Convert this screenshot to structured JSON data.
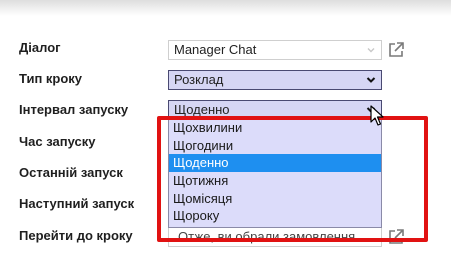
{
  "form": {
    "labels": {
      "dialog": "Діалог",
      "step_type": "Тип кроку",
      "interval": "Інтервал запуску",
      "run_time": "Час запуску",
      "last_run": "Останній запуск",
      "next_run": "Наступний запуск",
      "go_to_step": "Перейти до кроку"
    },
    "dialog_value": "Manager Chat",
    "step_type_value": "Розклад",
    "interval_value": "Щоденно",
    "go_to_step_value": "Отже, ви обрали замовлення"
  },
  "interval_dropdown": {
    "options": [
      "Щохвилини",
      "Щогодини",
      "Щоденно",
      "Щотижня",
      "Щомісяця",
      "Щороку"
    ],
    "selected": "Щоденно"
  },
  "colors": {
    "highlight_box": "#e11212",
    "selected_option": "#1e8ff0",
    "dropdown_bg": "#dcdcfa",
    "select_bg": "#d6d6f4"
  },
  "icons": [
    "external-link-icon",
    "chevron-down-icon",
    "mouse-cursor-icon"
  ]
}
